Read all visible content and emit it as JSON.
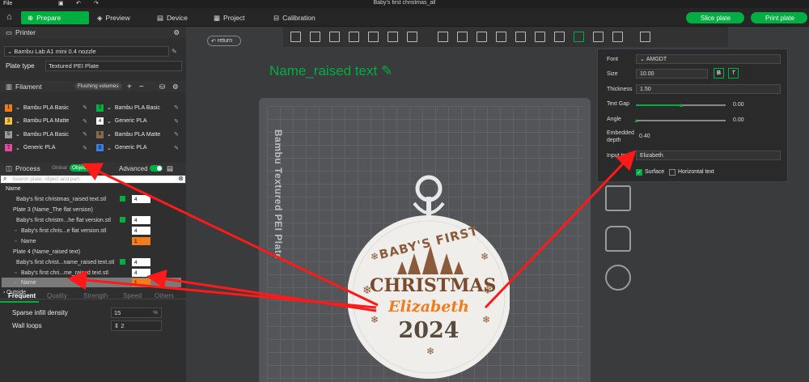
{
  "window": {
    "title": "Baby's first christmas_all",
    "file_menu": "File"
  },
  "nav": {
    "tabs": [
      {
        "label": "Prepare"
      },
      {
        "label": "Preview"
      },
      {
        "label": "Device"
      },
      {
        "label": "Project"
      },
      {
        "label": "Calibration"
      }
    ],
    "slice_button": "Slice plate",
    "print_button": "Print plate"
  },
  "printer": {
    "section_label": "Printer",
    "name": "Bambu Lab A1 mini 0.4 nozzle",
    "plate_type_label": "Plate type",
    "plate_type": "Textured PEI Plate"
  },
  "filament": {
    "section_label": "Filament",
    "flushing_label": "Flushing volumes",
    "items": [
      {
        "num": "1",
        "name": "Bambu PLA Basic",
        "color": "#f07c1e"
      },
      {
        "num": "2",
        "name": "Bambu PLA Basic",
        "color": "#00ae42"
      },
      {
        "num": "3",
        "name": "Bambu PLA Matte",
        "color": "#f3c44c"
      },
      {
        "num": "4",
        "name": "Generic PLA",
        "color": "#ffffff"
      },
      {
        "num": "5",
        "name": "Bambu PLA Basic",
        "color": "#9a9a9a"
      },
      {
        "num": "6",
        "name": "Bambu PLA Matte",
        "color": "#8a6a4a"
      },
      {
        "num": "7",
        "name": "Generic PLA",
        "color": "#e04aa0"
      },
      {
        "num": "8",
        "name": "Generic PLA",
        "color": "#3a7ee0"
      }
    ]
  },
  "process": {
    "section_label": "Process",
    "global_label": "Global",
    "objects_label": "Objects",
    "advanced_label": "Advanced",
    "search_placeholder": "Search plate, object and part.",
    "name_header": "Name",
    "rows": [
      {
        "label": "Baby's first christmas_raised text.stl",
        "num": "4"
      },
      {
        "label": "Plate 3 (Name_The flat version)",
        "num": ""
      },
      {
        "label": "Baby's first christm...he flat version.stl",
        "num": "4"
      },
      {
        "label": "Baby's first chris...e flat version.stl",
        "num": "4"
      },
      {
        "label": "Name",
        "num": "1"
      },
      {
        "label": "Plate 4 (Name_raised text)",
        "num": ""
      },
      {
        "label": "Baby's first christ...name_raised text.stl",
        "num": "4"
      },
      {
        "label": "Baby's first chri...me_raised text.stl",
        "num": "4"
      },
      {
        "label": "Name",
        "num": "1"
      },
      {
        "label": "Outside",
        "num": ""
      }
    ]
  },
  "settings_tabs": [
    "Frequent",
    "Quality",
    "Strength",
    "Speed",
    "Others"
  ],
  "settings": {
    "sparse_label": "Sparse infill density",
    "sparse_value": "15",
    "sparse_unit": "%",
    "wall_label": "Wall loops",
    "wall_value": "2"
  },
  "canvas": {
    "return_label": "return",
    "object_name": "Name_raised text",
    "plate_label": "Bambu Textured PEI Plate",
    "ornament": {
      "line1": "BABY'S FIRST",
      "line2": "CHRISTMAS",
      "line3": "Elizabeth",
      "line4": "2024"
    }
  },
  "text_panel": {
    "font_label": "Font",
    "font_value": "AMGDT",
    "size_label": "Size",
    "size_value": "10.00",
    "bold": "B",
    "italic": "T",
    "thickness_label": "Thickness",
    "thickness_value": "1.50",
    "gap_label": "Text Gap",
    "gap_value": "0.00",
    "gap_fraction": 0.5,
    "angle_label": "Angle",
    "angle_value": "0.00",
    "angle_fraction": 0.0,
    "depth_label1": "Embedded",
    "depth_label2": "depth",
    "depth_value": "0.40",
    "input_label": "Input text",
    "input_value": "Elizabeth",
    "surface_label": "Surface",
    "horizontal_label": "Horizontal text"
  },
  "colors": {
    "accent": "#00ae42",
    "annotation": "#ff1a1a",
    "orange": "#f07c1e",
    "ornament_text": "#8a5a3a"
  }
}
